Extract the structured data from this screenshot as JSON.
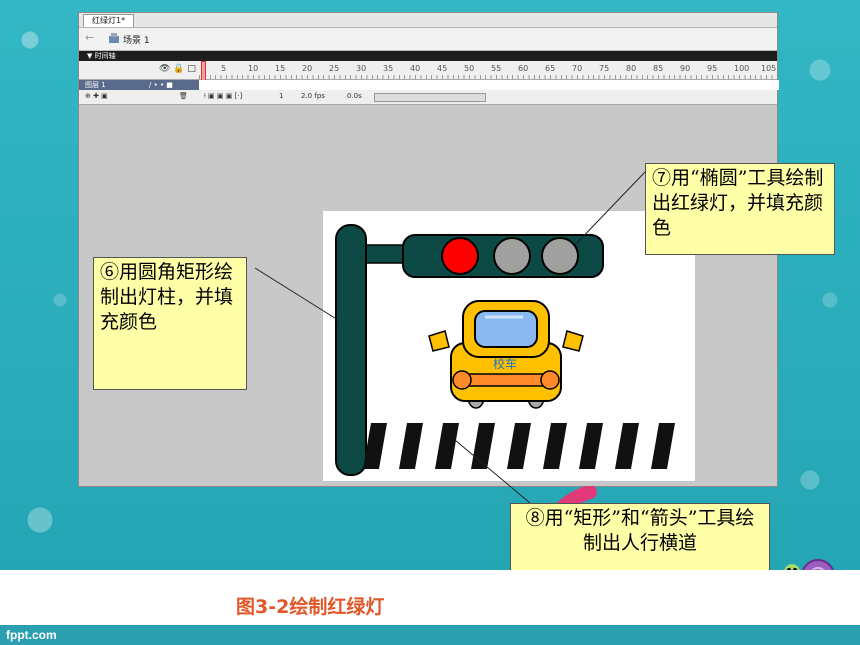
{
  "window": {
    "document_tab": "红绿灯1*",
    "scene_label": "场景 1",
    "timeline_header": "▼ 时间轴",
    "ruler_numbers": [
      "5",
      "10",
      "15",
      "20",
      "25",
      "30",
      "35",
      "40",
      "45",
      "50",
      "55",
      "60",
      "65",
      "70",
      "75",
      "80",
      "85",
      "90",
      "95",
      "100",
      "105"
    ],
    "layer_name": "图层 1",
    "status": {
      "frame": "1",
      "fps": "2.0 fps",
      "time": "0.0s"
    }
  },
  "stage": {
    "bus_label": "校车"
  },
  "callouts": {
    "c6": "⑥用圆角矩形绘制出灯柱，并填充颜色",
    "c7": "⑦用“椭圆”工具绘制出红绿灯，并填充颜色",
    "c8": "⑧用“矩形”和“箭头”工具绘制出人行横道"
  },
  "caption": "图3-2绘制红绿灯",
  "footer": "fppt.com",
  "colors": {
    "pole": "#0d4a46",
    "red_light": "#ff0000",
    "grey_light": "#a0a0a0",
    "bus_body": "#ffc000",
    "bus_window": "#8ab8f0",
    "bus_stripe": "#ff8a2a",
    "callout_bg": "#ffffa8",
    "caption": "#e2572a"
  }
}
